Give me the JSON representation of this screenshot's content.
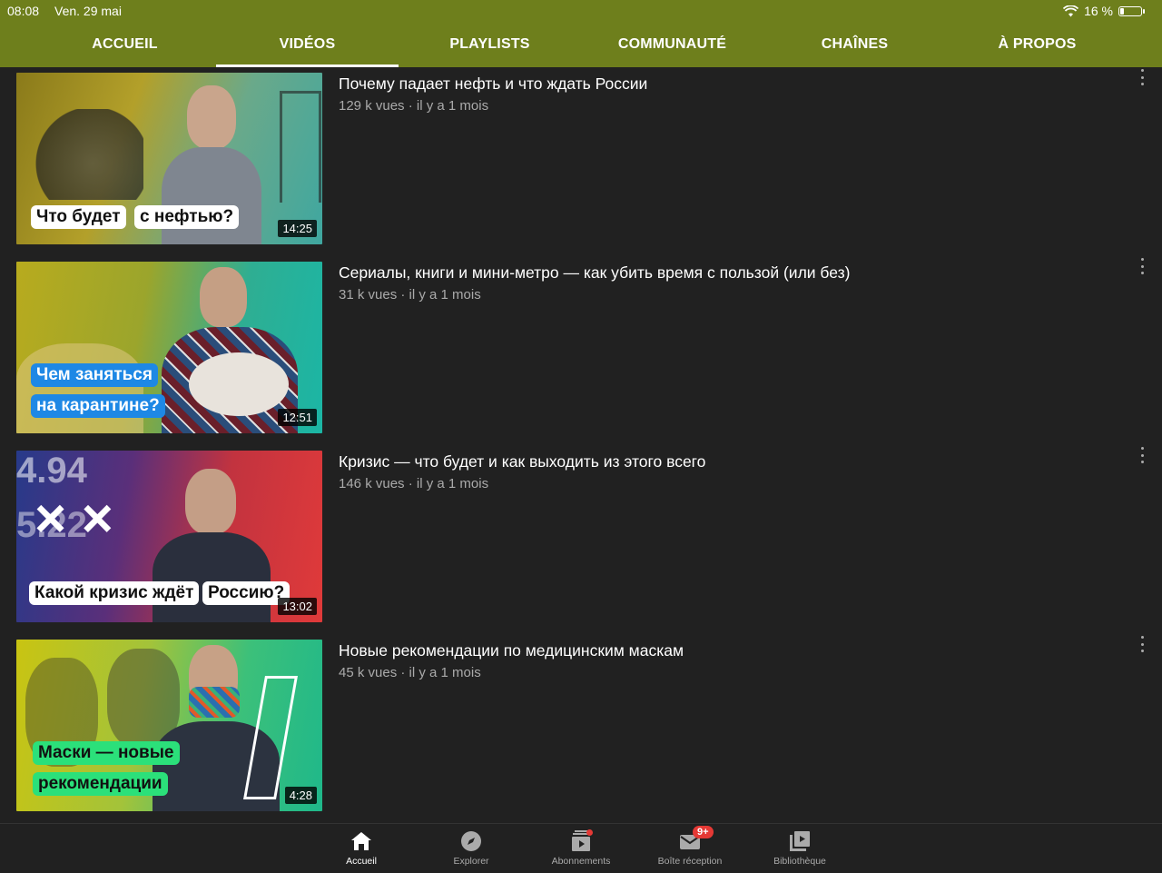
{
  "status": {
    "time": "08:08",
    "date": "Ven. 29 mai",
    "battery": "16 %",
    "battery_level": 0.16
  },
  "tabs": [
    {
      "label": "ACCUEIL"
    },
    {
      "label": "VIDÉOS",
      "active": true
    },
    {
      "label": "PLAYLISTS"
    },
    {
      "label": "COMMUNAUTÉ"
    },
    {
      "label": "CHAÎNES"
    },
    {
      "label": "À PROPOS"
    }
  ],
  "videos": [
    {
      "title": "Почему падает нефть и что ждать России",
      "meta": "129 k vues · il y a 1 mois",
      "duration": "14:25",
      "overlay": [
        "Что будет",
        "с нефтью?"
      ]
    },
    {
      "title": "Сериалы, книги и мини-метро — как убить время с пользой (или без)",
      "meta": "31 k vues · il y a 1 mois",
      "duration": "12:51",
      "overlay": [
        "Чем заняться",
        "на карантине?"
      ]
    },
    {
      "title": "Кризис — что будет и как выходить из этого всего",
      "meta": "146 k vues · il y a 1 mois",
      "duration": "13:02",
      "overlay": [
        "Какой кризис ждёт",
        "Россию?"
      ]
    },
    {
      "title": "Новые рекомендации по медицинским маскам",
      "meta": "45 k vues · il y a 1 mois",
      "duration": "4:28",
      "overlay": [
        "Маски — новые",
        "рекомендации"
      ]
    }
  ],
  "bottom_nav": [
    {
      "label": "Accueil",
      "icon": "home-icon",
      "active": true
    },
    {
      "label": "Explorer",
      "icon": "compass-icon"
    },
    {
      "label": "Abonnements",
      "icon": "subscriptions-icon"
    },
    {
      "label": "Boîte réception",
      "icon": "inbox-icon",
      "badge": "9+"
    },
    {
      "label": "Bibliothèque",
      "icon": "library-icon"
    }
  ],
  "colors": {
    "header": "#6e7f1c",
    "background": "#212121",
    "badge": "#e53935"
  }
}
